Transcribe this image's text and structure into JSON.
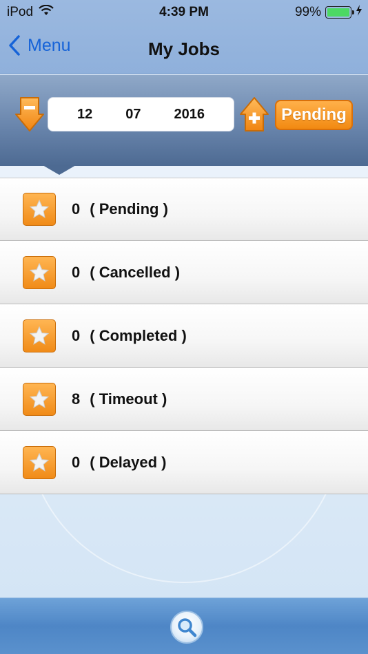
{
  "status_bar": {
    "carrier": "iPod",
    "time": "4:39 PM",
    "battery_percent": "99%",
    "battery_level": 0.99,
    "wifi_icon": "wifi-icon",
    "charging_icon": "bolt-icon"
  },
  "nav": {
    "back_label": "Menu",
    "title": "My Jobs"
  },
  "date_picker": {
    "day": "12",
    "month": "07",
    "year": "2016",
    "decrement_icon": "minus-arrow-down-icon",
    "increment_icon": "plus-arrow-up-icon"
  },
  "filter_button": {
    "label": "Pending"
  },
  "job_rows": [
    {
      "count": "0",
      "status": "( Pending )"
    },
    {
      "count": "0",
      "status": "( Cancelled )"
    },
    {
      "count": "0",
      "status": "( Completed )"
    },
    {
      "count": "8",
      "status": "( Timeout )"
    },
    {
      "count": "0",
      "status": "( Delayed )"
    }
  ],
  "bottom_bar": {
    "search_icon": "search-icon"
  },
  "colors": {
    "accent_orange": "#f28a12",
    "nav_blue": "#8fb0db",
    "link_blue": "#1663d8",
    "battery_green": "#4cd964"
  }
}
